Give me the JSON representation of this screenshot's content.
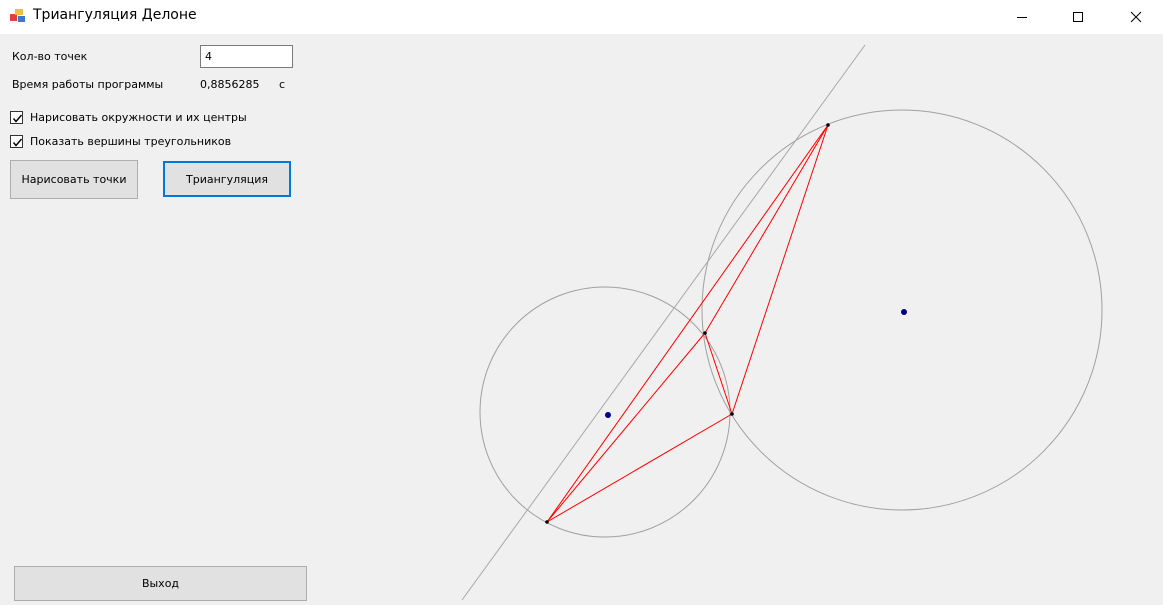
{
  "window": {
    "title": "Триангуляция Делоне"
  },
  "form": {
    "points_label": "Кол-во точек",
    "points_value": "4",
    "time_label": "Время работы программы",
    "time_value": "0,8856285",
    "time_unit": "с",
    "draw_circles_label": "Нарисовать окружности и их центры",
    "draw_circles_checked": true,
    "show_vertices_label": "Показать вершины треугольников",
    "show_vertices_checked": true,
    "draw_points_button": "Нарисовать точки",
    "triangulate_button": "Триангуляция",
    "exit_button": "Выход"
  },
  "colors": {
    "edge": "#ff0000",
    "circle": "#a0a0a0",
    "center": "#00008b",
    "vertex": "#000000"
  }
}
